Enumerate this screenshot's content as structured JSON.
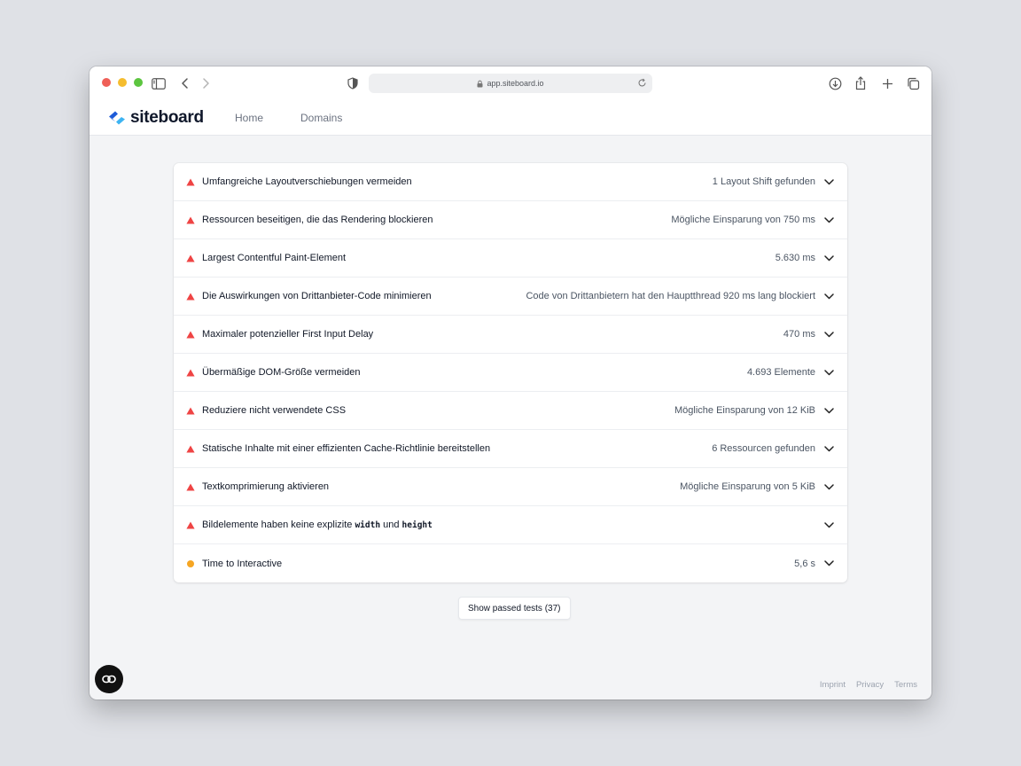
{
  "browser": {
    "url": "app.siteboard.io"
  },
  "app": {
    "logo_text": "siteboard",
    "nav": [
      {
        "label": "Home"
      },
      {
        "label": "Domains"
      }
    ]
  },
  "colors": {
    "warning_red": "#ef4444",
    "notice_orange": "#f6a623",
    "logo_blue": "#1e5bd8",
    "logo_cyan": "#3db4f2"
  },
  "audits": [
    {
      "status": "fail",
      "icon": "warning-triangle-icon",
      "title": "Umfangreiche Layoutverschiebungen vermeiden",
      "value": "1 Layout Shift gefunden"
    },
    {
      "status": "fail",
      "icon": "warning-triangle-icon",
      "title": "Ressourcen beseitigen, die das Rendering blockieren",
      "value": "Mögliche Einsparung von 750 ms"
    },
    {
      "status": "fail",
      "icon": "warning-triangle-icon",
      "title": "Largest Contentful Paint-Element",
      "value": "5.630 ms"
    },
    {
      "status": "fail",
      "icon": "warning-triangle-icon",
      "title": "Die Auswirkungen von Drittanbieter-Code minimieren",
      "value": "Code von Drittanbietern hat den Hauptthread 920 ms lang blockiert"
    },
    {
      "status": "fail",
      "icon": "warning-triangle-icon",
      "title": "Maximaler potenzieller First Input Delay",
      "value": "470 ms"
    },
    {
      "status": "fail",
      "icon": "warning-triangle-icon",
      "title": "Übermäßige DOM-Größe vermeiden",
      "value": "4.693 Elemente"
    },
    {
      "status": "fail",
      "icon": "warning-triangle-icon",
      "title": "Reduziere nicht verwendete CSS",
      "value": "Mögliche Einsparung von 12 KiB"
    },
    {
      "status": "fail",
      "icon": "warning-triangle-icon",
      "title": "Statische Inhalte mit einer effizienten Cache-Richtlinie bereitstellen",
      "value": "6 Ressourcen gefunden"
    },
    {
      "status": "fail",
      "icon": "warning-triangle-icon",
      "title": "Textkomprimierung aktivieren",
      "value": "Mögliche Einsparung von 5 KiB"
    },
    {
      "status": "fail",
      "icon": "warning-triangle-icon",
      "title_parts": [
        "Bildelemente haben keine explizite ",
        "width",
        " und ",
        "height"
      ],
      "value": ""
    },
    {
      "status": "average",
      "icon": "orange-circle-icon",
      "title": "Time to Interactive",
      "value": "5,6 s"
    }
  ],
  "passed_button_label": "Show passed tests (37)",
  "footer_links": [
    {
      "label": "Imprint"
    },
    {
      "label": "Privacy"
    },
    {
      "label": "Terms"
    }
  ]
}
